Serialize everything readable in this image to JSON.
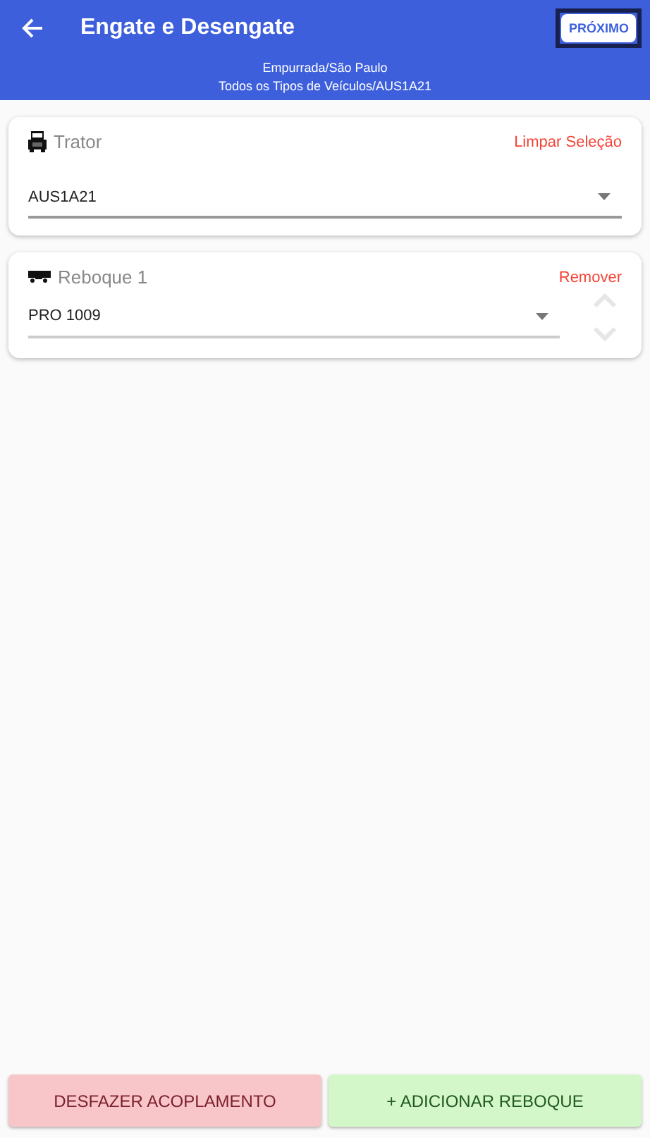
{
  "header": {
    "title": "Engate e Desengate",
    "next_button": "PRÓXIMO",
    "subtitle_lines": [
      "Empurrada/São Paulo",
      "Todos os Tipos de Veículos/AUS1A21"
    ]
  },
  "vehicles": [
    {
      "kind": "tractor",
      "label": "Trator",
      "action": "Limpar Seleção",
      "value": "AUS1A21"
    },
    {
      "kind": "trailer",
      "label": "Reboque 1",
      "action": "Remover",
      "value": "PRO 1009",
      "move_up_disabled": true,
      "move_down_disabled": true
    }
  ],
  "footer": {
    "buttons": [
      {
        "kind": "danger",
        "label": "DESFAZER ACOPLAMENTO"
      },
      {
        "kind": "success",
        "label": "+ ADICIONAR REBOQUE"
      }
    ]
  }
}
